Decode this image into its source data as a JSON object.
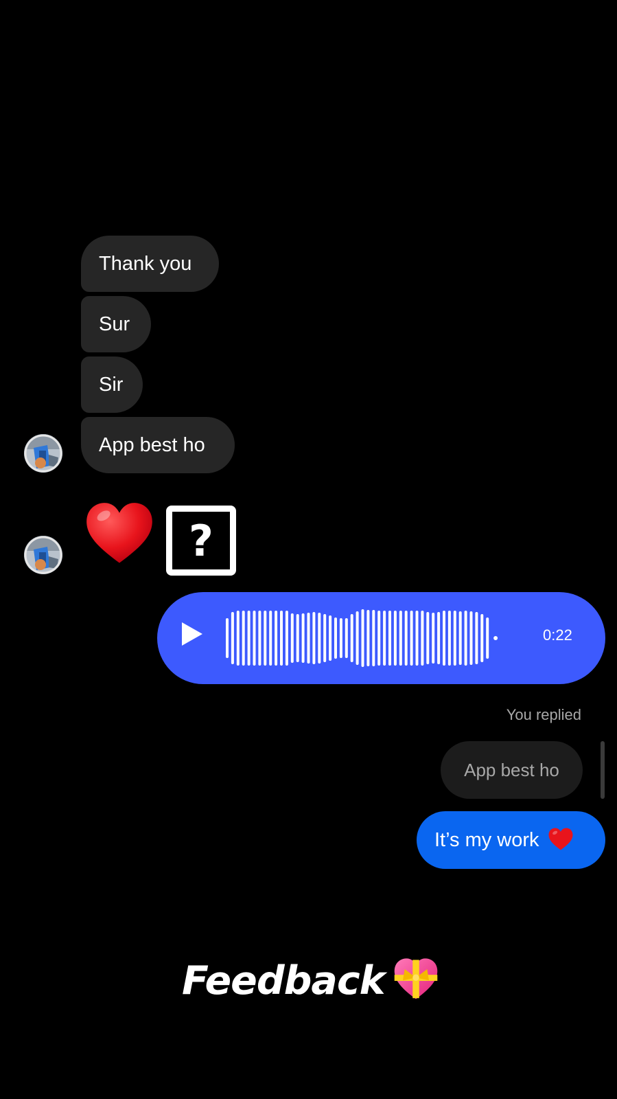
{
  "conversation": {
    "incoming": [
      {
        "text": "Thank you"
      },
      {
        "text": "Sur"
      },
      {
        "text": "Sir"
      },
      {
        "text": "App best ho"
      }
    ],
    "emoji_message": {
      "heart_icon": "red-heart-emoji",
      "unknown_icon": "unsupported-glyph-question-box",
      "unknown_glyph": "?"
    },
    "voice_message": {
      "duration": "0:22",
      "play_icon": "play-icon"
    },
    "reply": {
      "label": "You replied",
      "quoted_text": "App best ho",
      "text": "It’s my work"
    }
  },
  "overlay": {
    "caption": "Feedback",
    "caption_icon": "heart-with-ribbon-emoji"
  },
  "colors": {
    "background": "#000000",
    "incoming_bubble": "#262626",
    "voice_bubble": "#3d5afe",
    "outgoing_bubble": "#0a66f0",
    "muted_text": "#a8a8a8"
  }
}
